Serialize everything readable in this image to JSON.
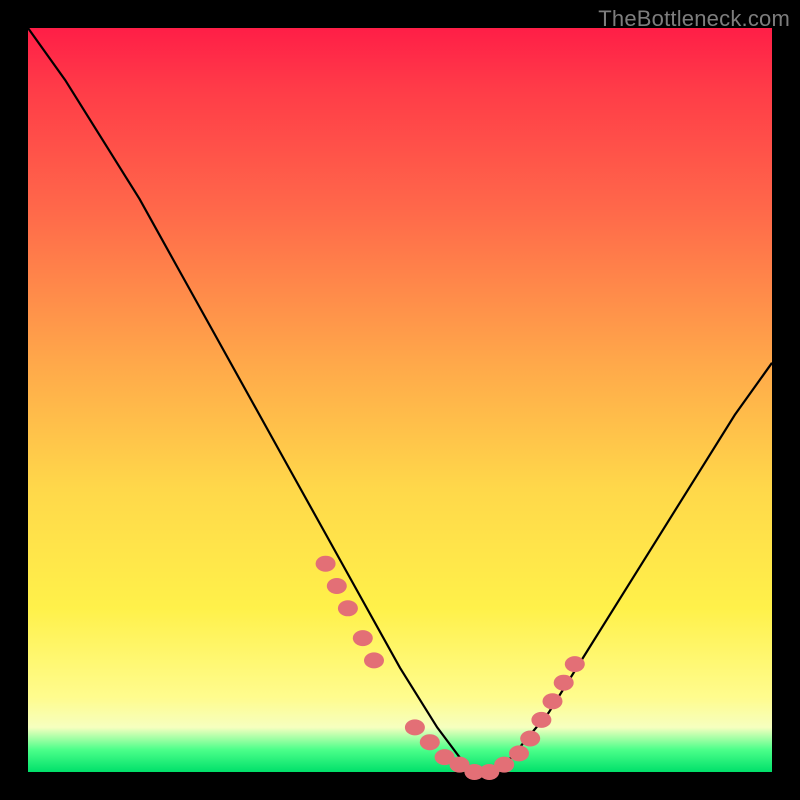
{
  "watermark": "TheBottleneck.com",
  "colors": {
    "background": "#000000",
    "gradient_top": "#ff1e47",
    "gradient_mid1": "#ff6a4a",
    "gradient_mid2": "#ffd84a",
    "gradient_bottom": "#00e06a",
    "curve": "#000000",
    "markers": "#e36f76"
  },
  "chart_data": {
    "type": "line",
    "title": "",
    "xlabel": "",
    "ylabel": "",
    "xlim": [
      0,
      100
    ],
    "ylim": [
      0,
      100
    ],
    "curve": {
      "name": "bottleneck-curve",
      "x": [
        0,
        5,
        10,
        15,
        20,
        25,
        30,
        35,
        40,
        45,
        50,
        55,
        58,
        60,
        63,
        65,
        70,
        75,
        80,
        85,
        90,
        95,
        100
      ],
      "y": [
        100,
        93,
        85,
        77,
        68,
        59,
        50,
        41,
        32,
        23,
        14,
        6,
        2,
        0,
        0,
        2,
        8,
        16,
        24,
        32,
        40,
        48,
        55
      ]
    },
    "markers": {
      "name": "highlight-dots",
      "x": [
        40,
        41.5,
        43,
        45,
        46.5,
        52,
        54,
        56,
        58,
        60,
        62,
        64,
        66,
        67.5,
        69,
        70.5,
        72,
        73.5
      ],
      "y": [
        28,
        25,
        22,
        18,
        15,
        6,
        4,
        2,
        1,
        0,
        0,
        1,
        2.5,
        4.5,
        7,
        9.5,
        12,
        14.5
      ]
    }
  }
}
